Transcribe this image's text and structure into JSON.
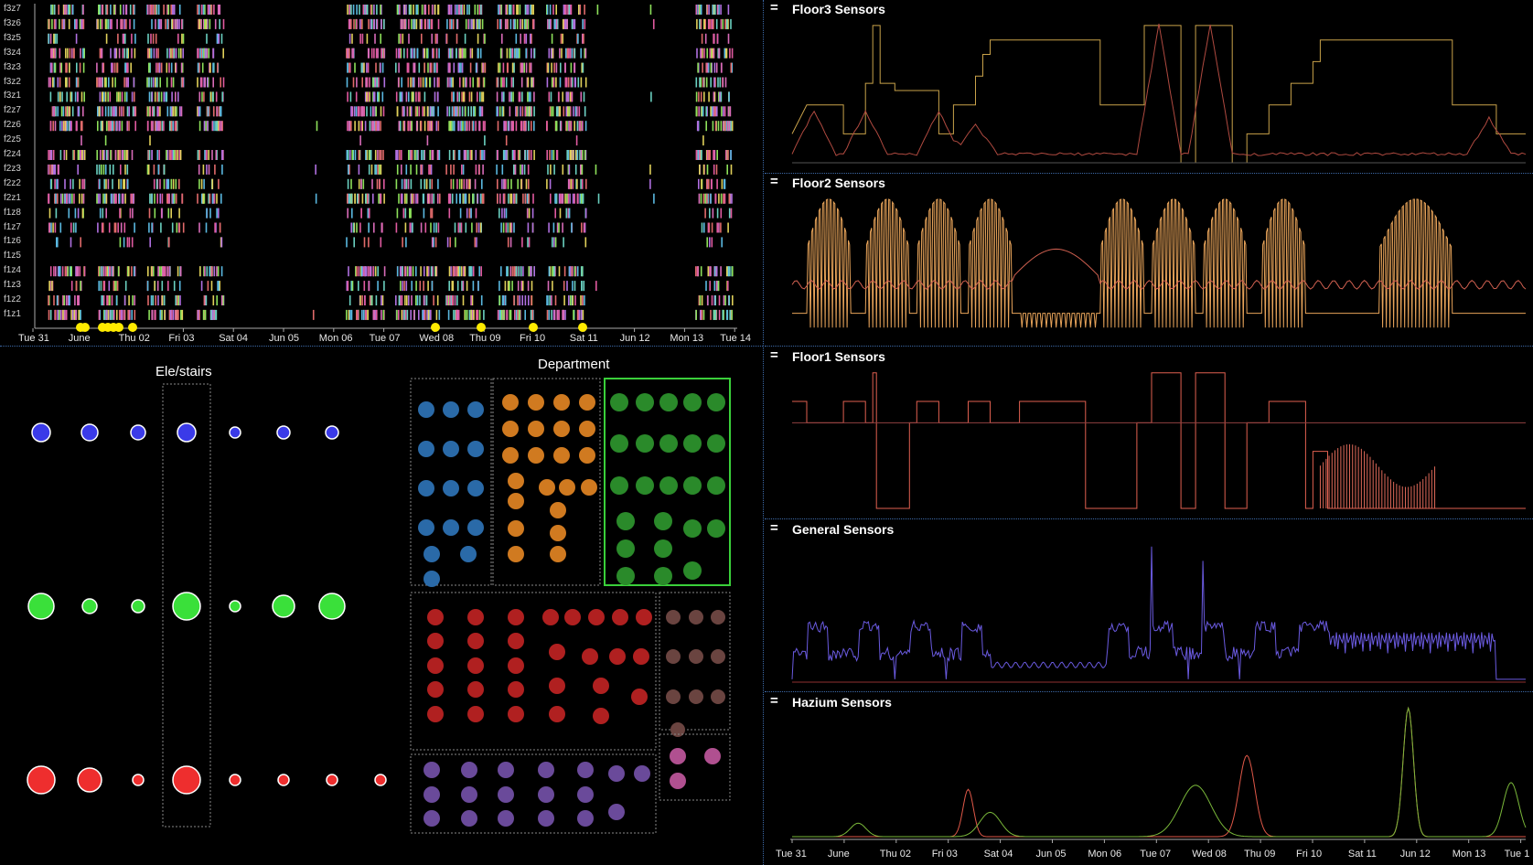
{
  "timeline": {
    "rows": [
      "f3z7",
      "f3z6",
      "f3z5",
      "f3z4",
      "f3z3",
      "f3z2",
      "f3z1",
      "f2z7",
      "f2z6",
      "f2z5",
      "f2z4",
      "f2z3",
      "f2z2",
      "f2z1",
      "f1z8",
      "f1z7",
      "f1z6",
      "f1z5",
      "f1z4",
      "f1z3",
      "f1z2",
      "f1z1"
    ],
    "xticks": [
      "Tue 31",
      "June",
      "Thu 02",
      "Fri 03",
      "Sat 04",
      "Jun 05",
      "Mon 06",
      "Tue 07",
      "Wed 08",
      "Thu 09",
      "Fri 10",
      "Sat 11",
      "Jun 12",
      "Mon 13",
      "Tue 14"
    ],
    "event_marker_color": "#ffeb00"
  },
  "elevator": {
    "title": "Ele/stairs"
  },
  "department": {
    "title": "Department"
  },
  "strips": [
    {
      "handle": "=",
      "title": "Floor3 Sensors"
    },
    {
      "handle": "=",
      "title": "Floor2 Sensors"
    },
    {
      "handle": "=",
      "title": "Floor1 Sensors"
    },
    {
      "handle": "=",
      "title": "General Sensors"
    },
    {
      "handle": "=",
      "title": "Hazium Sensors"
    }
  ],
  "bottom_axis": {
    "xticks": [
      "Tue 31",
      "June",
      "Thu 02",
      "Fri 03",
      "Sat 04",
      "Jun 05",
      "Mon 06",
      "Tue 07",
      "Wed 08",
      "Thu 09",
      "Fri 10",
      "Sat 11",
      "Jun 12",
      "Mon 13",
      "Tue 1"
    ]
  },
  "colors": {
    "accent_blue": "#3d6aa8",
    "floor3": "#c9a24a",
    "floor2": "#e8a45a",
    "floor1": "#e06050",
    "general": "#6a5ae0",
    "hazium_green": "#7ab83a",
    "hazium_red": "#e05848"
  }
}
